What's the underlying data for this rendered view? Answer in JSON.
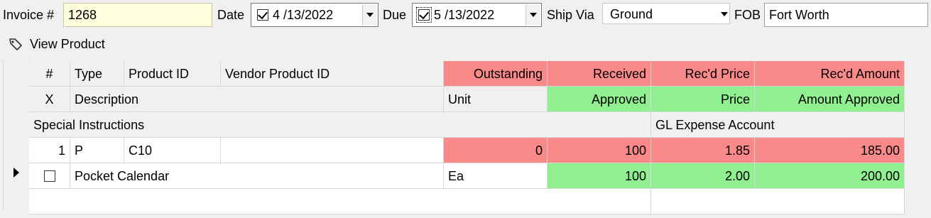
{
  "form": {
    "invoice_label": "Invoice #",
    "invoice_value": "1268",
    "date_label": "Date",
    "date_checked": true,
    "date_value": "4 /13/2022",
    "due_label": "Due",
    "due_checked": true,
    "due_value": "5 /13/2022",
    "ship_via_label": "Ship Via",
    "ship_via_value": "Ground",
    "fob_label": "FOB",
    "fob_value": "Fort Worth"
  },
  "toolbar": {
    "view_product_label": "View Product",
    "view_product_icon": "tag-icon"
  },
  "grid": {
    "header_row1": {
      "num": "#",
      "type": "Type",
      "product_id": "Product ID",
      "vendor_product_id": "Vendor Product ID",
      "outstanding": "Outstanding",
      "received": "Received",
      "recd_price": "Rec'd Price",
      "recd_amount": "Rec'd Amount"
    },
    "header_row2": {
      "x": "X",
      "description": "Description",
      "unit": "Unit",
      "approved": "Approved",
      "price": "Price",
      "amount_approved": "Amount Approved"
    },
    "header_row3": {
      "special_instructions": "Special Instructions",
      "gl_expense_account": "GL Expense Account"
    },
    "rows": [
      {
        "num": "1",
        "type": "P",
        "product_id": "C10",
        "vendor_product_id": "",
        "outstanding": "0",
        "received": "100",
        "recd_price": "1.85",
        "recd_amount": "185.00",
        "x_checked": false,
        "description": "Pocket Calendar",
        "unit": "Ea",
        "approved": "100",
        "price": "2.00",
        "amount_approved": "200.00",
        "special_instructions": "",
        "gl_expense_account": ""
      }
    ],
    "colors": {
      "red": "#fa8a8a",
      "green": "#90f090"
    }
  }
}
